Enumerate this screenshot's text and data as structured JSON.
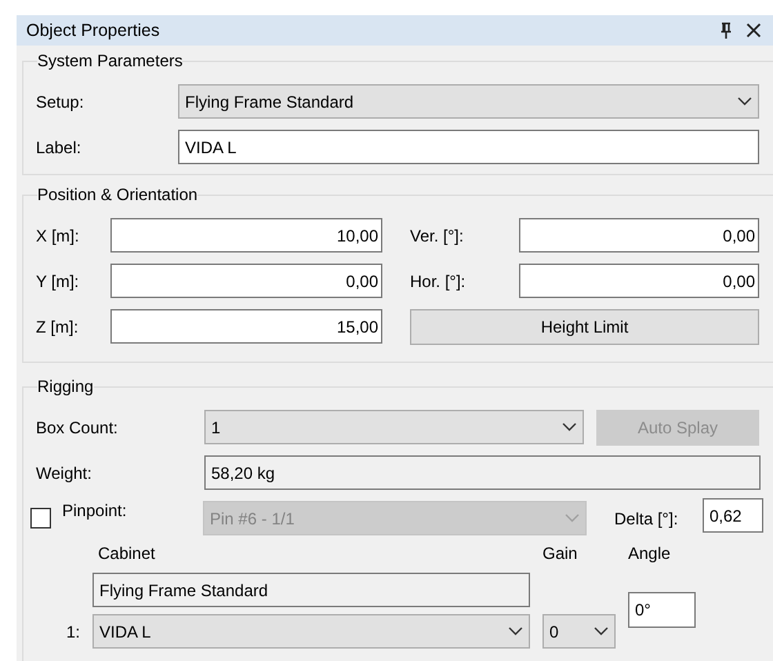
{
  "window": {
    "title": "Object Properties"
  },
  "system_parameters": {
    "title": "System Parameters",
    "setup": {
      "label": "Setup:",
      "value": "Flying Frame Standard"
    },
    "label": {
      "label": "Label:",
      "value": "VIDA L"
    }
  },
  "position_orientation": {
    "title": "Position & Orientation",
    "fields": [
      {
        "label": "X [m]:",
        "value": "10,00"
      },
      {
        "label": "Ver. [°]:",
        "value": "0,00"
      },
      {
        "label": "Y [m]:",
        "value": "0,00"
      },
      {
        "label": "Hor. [°]:",
        "value": "0,00"
      },
      {
        "label": "Z [m]:",
        "value": "15,00"
      }
    ],
    "button": {
      "label": "Height Limit",
      "disabled": false
    }
  },
  "rigging": {
    "title": "Rigging",
    "box_count": {
      "label": "Box Count:",
      "value": "1",
      "disabled": false
    },
    "auto_splay": {
      "label": "Auto Splay",
      "disabled": true
    },
    "weight": {
      "label": "Weight:",
      "value": "58,20 kg",
      "read_only": true
    },
    "pinpoint": {
      "label": "Pinpoint:",
      "checked": false,
      "value": "Pin #6 - 1/1",
      "disabled": true
    },
    "delta": {
      "label": "Delta [°]:",
      "value": "0,62"
    },
    "columns": [
      "Cabinet",
      "Gain",
      "Angle"
    ],
    "rows": [
      {
        "index": "1:",
        "frame": "Flying Frame Standard",
        "frame_read_only": true,
        "cabinet": "VIDA L",
        "gain": "0",
        "angle": "0°"
      }
    ]
  }
}
